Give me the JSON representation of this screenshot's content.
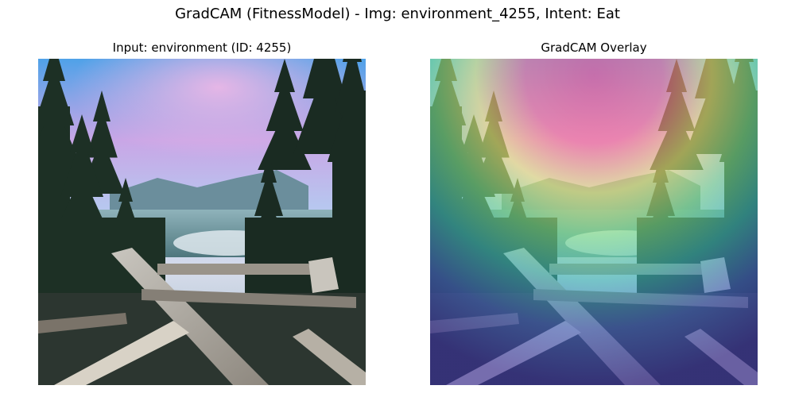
{
  "figure": {
    "suptitle": "GradCAM (FitnessModel) - Img: environment_4255, Intent: Eat"
  },
  "panels": [
    {
      "title": "Input: environment (ID: 4255)"
    },
    {
      "title": "GradCAM Overlay"
    }
  ],
  "colors": {
    "sky_top": "#5aa9e6",
    "sky_pink": "#e9b6e0",
    "forest_dark": "#1f3326",
    "lake": "#6f9aa3",
    "logs": "#a9a49a",
    "heat_hot": "#ff5a8a",
    "heat_mid": "#f5f07a",
    "heat_cool": "#3b3fb0"
  }
}
